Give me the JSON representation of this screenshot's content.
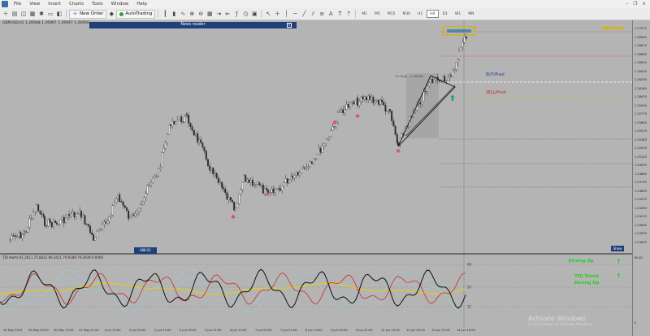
{
  "menu": [
    "File",
    "View",
    "Insert",
    "Charts",
    "Tools",
    "Window",
    "Help"
  ],
  "toolbar": {
    "new_order": "New Order",
    "auto_trading": "AutoTrading",
    "timeframes": [
      "M1",
      "M5",
      "M15",
      "M30",
      "H1",
      "H4",
      "D1",
      "W1",
      "MN"
    ],
    "active_timeframe": "H4"
  },
  "chart": {
    "title": "GBPUSD,H1  1.26948  1.26967  1.26947  1.26950",
    "news_reader": "News reader",
    "buy_pivot": "BUY/Pivot",
    "sell_pivot": "SELL/Pivot",
    "gold_label": "GBPUSD",
    "show_button": "Show",
    "time_box": "488:01",
    "swing_label": "Y's High : 1.26248"
  },
  "price_axis": [
    "1.27075",
    "1.26945",
    "1.26815",
    "1.26685",
    "1.26555",
    "1.26425",
    "1.26295",
    "1.26165",
    "1.26035",
    "1.25905",
    "1.25775",
    "1.25645",
    "1.25515",
    "1.25385",
    "1.25255",
    "1.25125",
    "1.24995",
    "1.24865",
    "1.24735",
    "1.24605",
    "1.24475",
    "1.24345",
    "1.24215",
    "1.24085",
    "1.23955",
    "1.23825"
  ],
  "tdi": {
    "title": "TDI Alerts  81.2611 75.8021 60.3411 79.9188 79.2939 0.0000",
    "levels": [
      "68",
      "50",
      "32"
    ],
    "axis_top": "90.87",
    "axis_bottom": "0",
    "signal_text_1": "Strong Up",
    "signal_text_2": "TDI Trend",
    "signal_text_3": "Strong Up"
  },
  "time_axis": [
    "26 May 2023",
    "29 May 05:00",
    "30 May 13:00",
    "31 May 21:00",
    "1 Jun 13:00",
    "2 Jun 05:00",
    "2 Jun 21:00",
    "5 Jun 05:00",
    "5 Jun 21:00",
    "6 Jun 13:00",
    "7 Jun 05:00",
    "7 Jun 21:00",
    "8 Jun 13:00",
    "9 Jun 05:00",
    "9 Jun 21:00",
    "12 Jun 13:00",
    "13 Jun 05:00",
    "13 Jun 21:00",
    "14 Jun 13:00"
  ],
  "watermark": "Activate Windows",
  "watermark_sub": "Go to Settings to activate Windows.",
  "colors": {
    "chart_bg": "#b4b4b4",
    "candle": "#3c3c3c",
    "gold": "#d8b000",
    "green": "#1fd01f",
    "navy": "#1f3f7a",
    "pink": "#e0399a"
  }
}
